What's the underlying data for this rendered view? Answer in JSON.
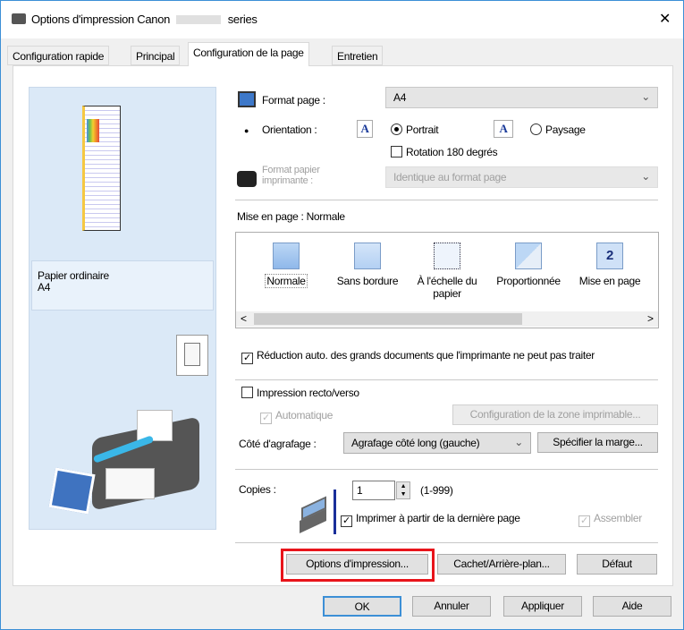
{
  "window": {
    "title": "Options d'impression Canon",
    "title_suffix": "series",
    "close": "✕"
  },
  "tabs": [
    {
      "label": "Configuration rapide",
      "active": false
    },
    {
      "label": "Principal",
      "active": false
    },
    {
      "label": "Configuration de la page",
      "active": true
    },
    {
      "label": "Entretien",
      "active": false
    }
  ],
  "preview": {
    "paper_type": "Papier ordinaire",
    "paper_size": "A4"
  },
  "page_format": {
    "label": "Format page :",
    "value": "A4"
  },
  "orientation": {
    "label": "Orientation :",
    "portrait": "Portrait",
    "landscape": "Paysage",
    "selected": "Portrait",
    "rotate_label": "Rotation 180 degrés",
    "rotate_checked": false,
    "icon_letter": "A"
  },
  "printer_paper": {
    "label": "Format papier imprimante :",
    "value": "Identique au format page"
  },
  "layout": {
    "label": "Mise en page :",
    "value": "Normale",
    "items": [
      "Normale",
      "Sans bordure",
      "À l'échelle du papier",
      "Proportionnée",
      "Mise en page"
    ],
    "selected": "Normale",
    "scroll_left": "<",
    "scroll_right": ">"
  },
  "auto_reduce": {
    "label": "Réduction auto. des grands documents que l'imprimante ne peut pas traiter",
    "checked": true
  },
  "duplex": {
    "label": "Impression recto/verso",
    "checked": false,
    "auto_label": "Automatique",
    "auto_checked": true,
    "print_area_button": "Configuration de la zone imprimable..."
  },
  "stapling": {
    "label": "Côté d'agrafage :",
    "value": "Agrafage côté long (gauche)",
    "margin_button": "Spécifier la marge..."
  },
  "copies": {
    "label": "Copies :",
    "value": "1",
    "range": "(1-999)",
    "reverse_label": "Imprimer à partir de la dernière page",
    "reverse_checked": true,
    "collate_label": "Assembler",
    "collate_checked": true
  },
  "page_buttons": {
    "print_options": "Options d'impression...",
    "stamp": "Cachet/Arrière-plan...",
    "default": "Défaut"
  },
  "dialog_buttons": {
    "ok": "OK",
    "cancel": "Annuler",
    "apply": "Appliquer",
    "help": "Aide"
  },
  "colors": {
    "highlight": "#e8141b",
    "accent": "#3c8fd6",
    "preview_bg": "#dbe9f7"
  }
}
